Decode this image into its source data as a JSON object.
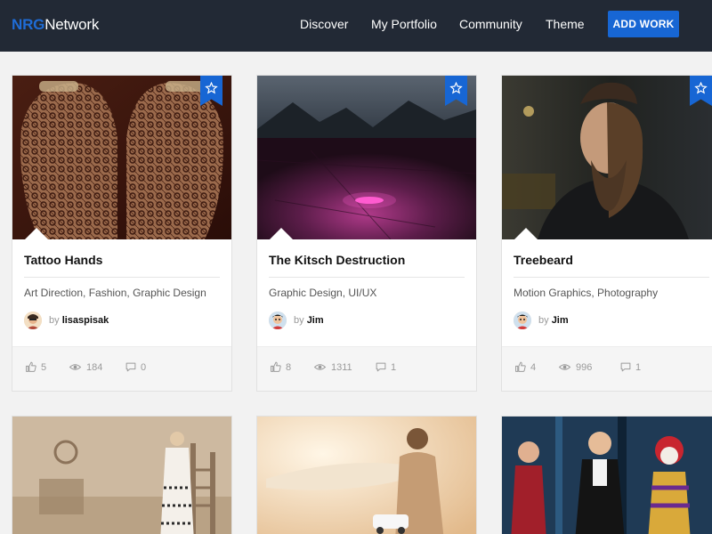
{
  "header": {
    "logo_part1": "NRG",
    "logo_part2": "Network",
    "nav": [
      "Discover",
      "My Portfolio",
      "Community",
      "Theme"
    ],
    "add_button": "ADD WORK"
  },
  "colors": {
    "accent": "#1766d4",
    "header_bg": "#222935"
  },
  "cards": [
    {
      "title": "Tattoo Hands",
      "tags": [
        {
          "t": "Art Direction"
        },
        {
          "t": "Fashion"
        },
        {
          "t": "Graphic Design"
        }
      ],
      "by": "by",
      "author": "lisaspisak",
      "likes": "5",
      "views": "184",
      "comments": "0"
    },
    {
      "title": "The Kitsch Destruction",
      "tags": [
        {
          "t": "Graphic Design"
        },
        {
          "t": "UI/UX"
        }
      ],
      "by": "by",
      "author": "Jim",
      "likes": "8",
      "views": "1311",
      "comments": "1"
    },
    {
      "title": "Treebeard",
      "tags": [
        {
          "t": "Motion Graphics"
        },
        {
          "t": "Photography"
        }
      ],
      "by": "by",
      "author": "Jim",
      "likes": "4",
      "views": "996",
      "comments": "1"
    }
  ],
  "icons": {
    "bookmark": "star-icon",
    "likes": "thumbs-up-icon",
    "views": "eye-icon",
    "comments": "speech-bubble-icon"
  }
}
